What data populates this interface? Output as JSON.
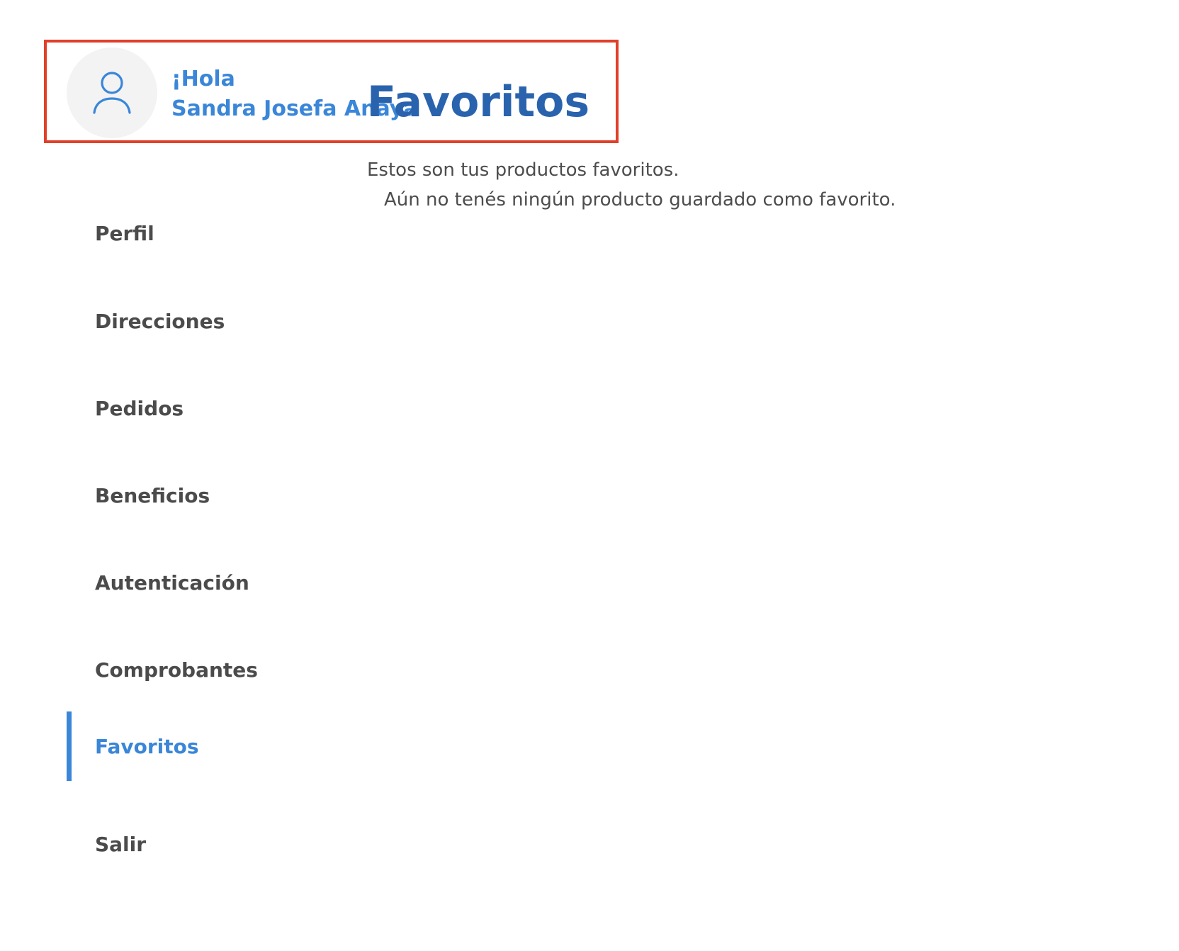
{
  "header": {
    "greeting": "¡Hola",
    "user_name": "Sandra Josefa Anaya"
  },
  "main": {
    "title": "Favoritos",
    "subtitle": "Estos son tus productos favoritos.",
    "empty_message": "Aún no tenés ningún producto guardado como favorito."
  },
  "sidebar": {
    "items": [
      {
        "label": "Perfil",
        "icon": "none",
        "active": false
      },
      {
        "label": "Direcciones",
        "icon": "none",
        "active": false
      },
      {
        "label": "Pedidos",
        "icon": "none",
        "active": false
      },
      {
        "label": "Beneficios",
        "icon": "none",
        "active": false
      },
      {
        "label": "Autenticación",
        "icon": "none",
        "active": false
      },
      {
        "label": "Comprobantes",
        "icon": "none",
        "active": false
      },
      {
        "label": "Favoritos",
        "icon": "none",
        "active": true
      },
      {
        "label": "Salir",
        "icon": "none",
        "active": false
      }
    ]
  },
  "icons": {
    "avatar": "user-outline-icon"
  },
  "colors": {
    "accent": "#3a86d8",
    "title": "#2a63ad",
    "text": "#4b4b4b",
    "highlight_border": "#e0402a",
    "avatar_bg": "#f3f3f3"
  }
}
